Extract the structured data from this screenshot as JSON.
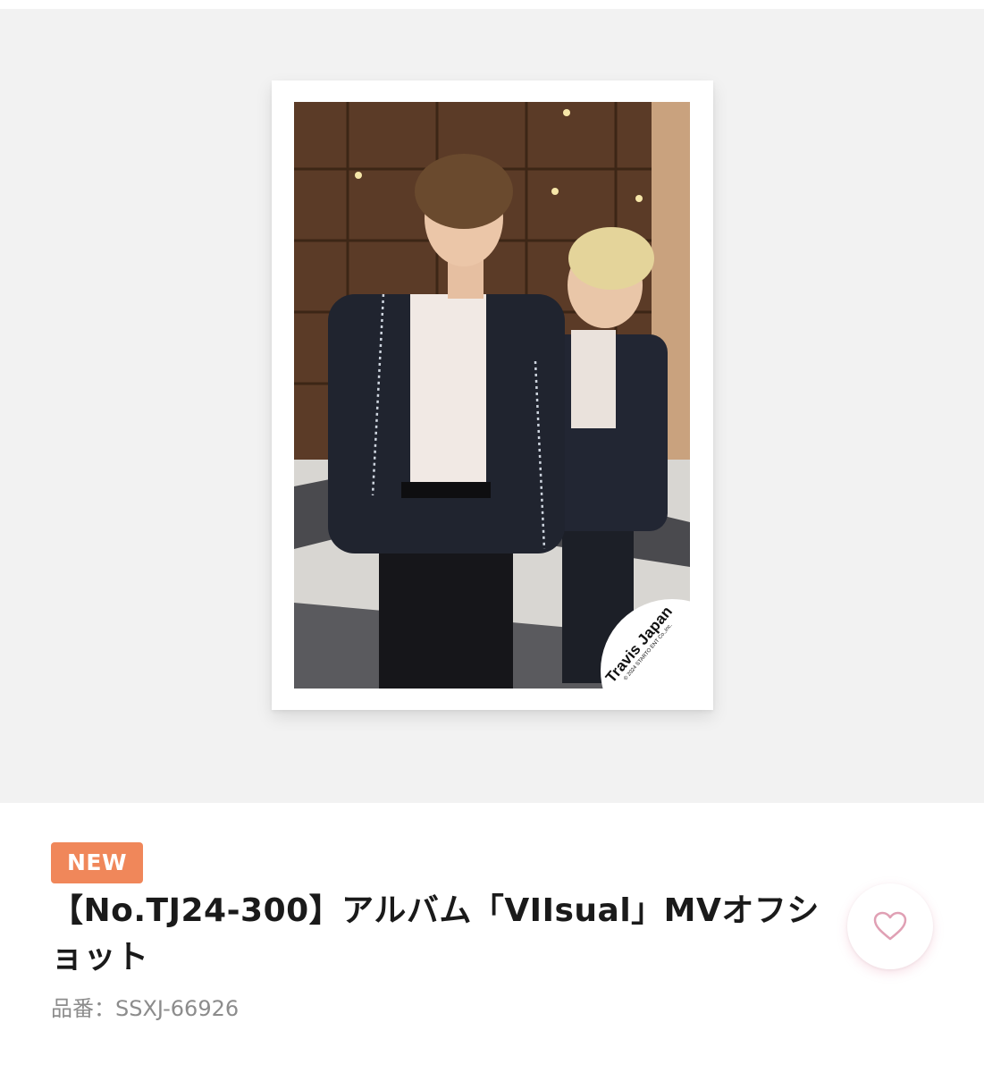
{
  "gallery": {
    "photo_alt": "Travis Japan members photo",
    "logo_text": "Travis Japan",
    "logo_copyright": "© 2024 STARTO ENT Co.,Inc."
  },
  "product": {
    "badge": "NEW",
    "title": "【No.TJ24-300】アルバム「VIIsual」MVオフショット",
    "code": "品番：SSXJ-66926"
  },
  "icons": {
    "favorite": "heart-outline-icon"
  },
  "colors": {
    "badge_bg": "#f0875a",
    "heart_stroke": "#e0a0b4",
    "gallery_bg": "#f2f2f2"
  }
}
